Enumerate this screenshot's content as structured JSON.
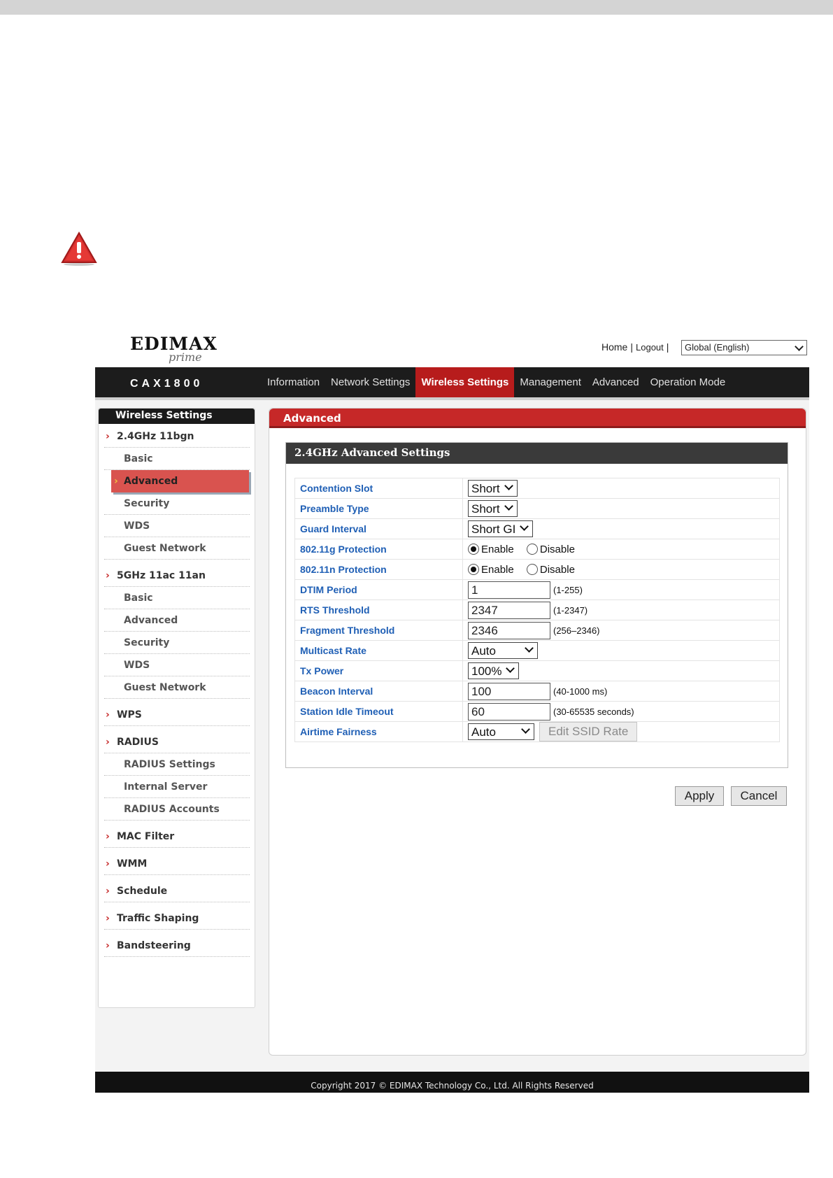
{
  "header": {
    "logo": "EDIMAX",
    "logo_sub": "prime",
    "links": [
      "Home",
      "Logout"
    ],
    "language": "Global (English)"
  },
  "nav": {
    "model": "CAX1800",
    "tabs": [
      "Information",
      "Network Settings",
      "Wireless Settings",
      "Management",
      "Advanced",
      "Operation Mode"
    ],
    "active_tab": "Wireless Settings"
  },
  "sidebar": {
    "title": "Wireless Settings",
    "items": [
      {
        "label": "2.4GHz 11bgn",
        "type": "category"
      },
      {
        "label": "Basic",
        "type": "sub"
      },
      {
        "label": "Advanced",
        "type": "sub",
        "active": true
      },
      {
        "label": "Security",
        "type": "sub"
      },
      {
        "label": "WDS",
        "type": "sub"
      },
      {
        "label": "Guest Network",
        "type": "sub"
      },
      {
        "label": "5GHz 11ac 11an",
        "type": "category"
      },
      {
        "label": "Basic",
        "type": "sub"
      },
      {
        "label": "Advanced",
        "type": "sub"
      },
      {
        "label": "Security",
        "type": "sub"
      },
      {
        "label": "WDS",
        "type": "sub"
      },
      {
        "label": "Guest Network",
        "type": "sub"
      },
      {
        "label": "WPS",
        "type": "category"
      },
      {
        "label": "RADIUS",
        "type": "category"
      },
      {
        "label": "RADIUS Settings",
        "type": "sub"
      },
      {
        "label": "Internal Server",
        "type": "sub"
      },
      {
        "label": "RADIUS Accounts",
        "type": "sub"
      },
      {
        "label": "MAC Filter",
        "type": "category"
      },
      {
        "label": "WMM",
        "type": "category"
      },
      {
        "label": "Schedule",
        "type": "category"
      },
      {
        "label": "Traffic Shaping",
        "type": "category"
      },
      {
        "label": "Bandsteering",
        "type": "category"
      }
    ]
  },
  "content": {
    "title": "Advanced",
    "panel_title": "2.4GHz Advanced Settings",
    "rows": {
      "contention_slot": {
        "label": "Contention Slot",
        "value": "Short"
      },
      "preamble_type": {
        "label": "Preamble Type",
        "value": "Short"
      },
      "guard_interval": {
        "label": "Guard Interval",
        "value": "Short GI"
      },
      "g_protection": {
        "label": "802.11g Protection",
        "opt1": "Enable",
        "opt2": "Disable",
        "selected": "Enable"
      },
      "n_protection": {
        "label": "802.11n Protection",
        "opt1": "Enable",
        "opt2": "Disable",
        "selected": "Enable"
      },
      "dtim_period": {
        "label": "DTIM Period",
        "value": "1",
        "hint": "(1-255)"
      },
      "rts_threshold": {
        "label": "RTS Threshold",
        "value": "2347",
        "hint": "(1-2347)"
      },
      "fragment_threshold": {
        "label": "Fragment Threshold",
        "value": "2346",
        "hint": "(256–2346)"
      },
      "multicast_rate": {
        "label": "Multicast Rate",
        "value": "Auto"
      },
      "tx_power": {
        "label": "Tx Power",
        "value": "100%"
      },
      "beacon_interval": {
        "label": "Beacon Interval",
        "value": "100",
        "hint": "(40-1000 ms)"
      },
      "station_idle_timeout": {
        "label": "Station Idle Timeout",
        "value": "60",
        "hint": "(30-65535 seconds)"
      },
      "airtime_fairness": {
        "label": "Airtime Fairness",
        "value": "Auto",
        "button": "Edit SSID Rate"
      }
    },
    "apply": "Apply",
    "cancel": "Cancel"
  },
  "footer": {
    "text": "Copyright 2017 © EDIMAX Technology Co., Ltd. All Rights Reserved"
  },
  "colors": {
    "accent": "#c62828",
    "nav_bg": "#1c1c1c",
    "label_blue": "#1f5fb5"
  }
}
